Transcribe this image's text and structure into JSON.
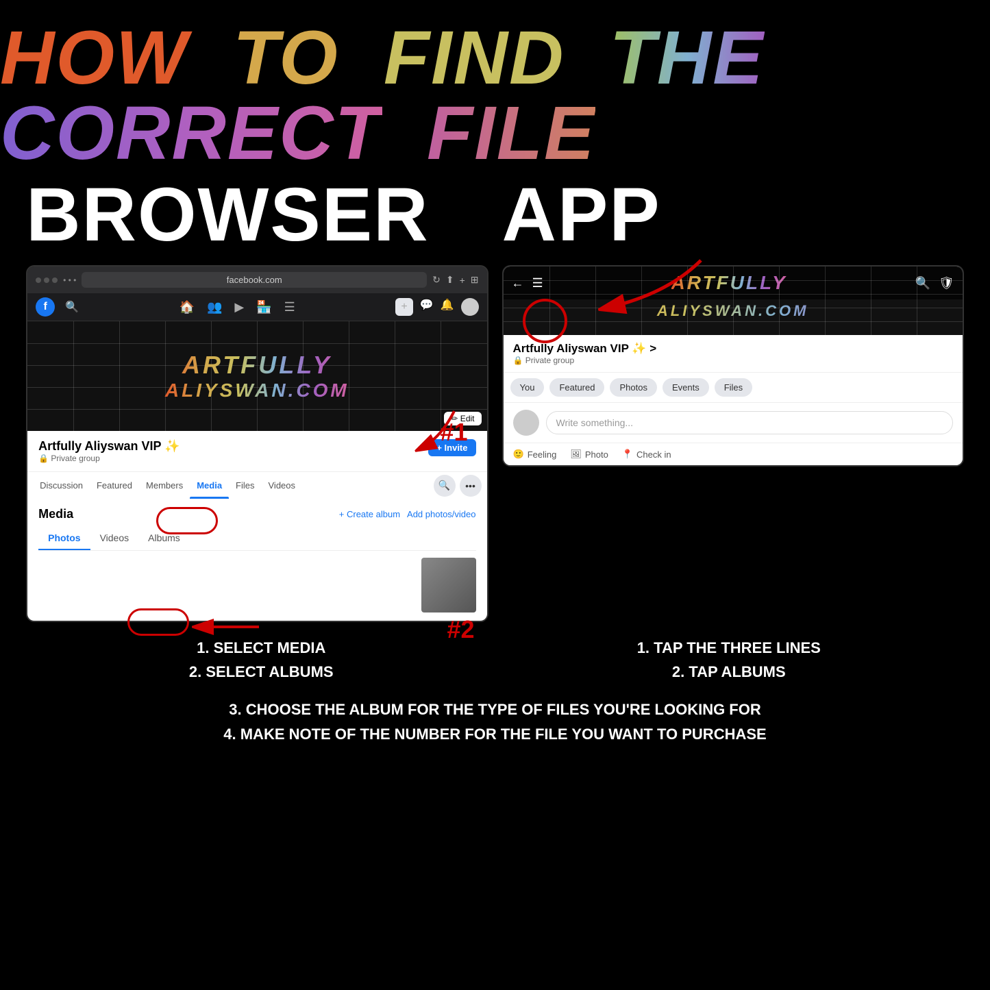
{
  "title": {
    "line1": "HOW TO FIND THE CORRECT FILE",
    "how": "HOW",
    "to": "TO",
    "find": "FIND",
    "the": "THE",
    "correct": "CORRECT",
    "file": "FILE"
  },
  "browser_column": {
    "label": "BROWSER",
    "browser_bar": {
      "url": "facebook.com"
    },
    "cover": {
      "line1": "ARTFULLY",
      "line2": "ALIYSWAN.COM"
    },
    "profile": {
      "name": "Artfully Aliyswan VIP ✨",
      "type": "🔒 Private group"
    },
    "tabs": [
      "Discussion",
      "Featured",
      "Members",
      "Media",
      "Files",
      "Videos"
    ],
    "media_section": {
      "title": "Media",
      "create_album": "+ Create album",
      "add_photos": "Add photos/video",
      "sub_tabs": [
        "Photos",
        "Videos",
        "Albums"
      ]
    },
    "invite_button": "+ Invite",
    "edit_button": "✏ Edit",
    "annotations": {
      "number1": "#1",
      "number2": "#2"
    }
  },
  "app_column": {
    "label": "APP",
    "cover": {
      "line1": "ARTFULLY",
      "line2": "ALIYSWAN.COM"
    },
    "profile": {
      "name": "Artfully Aliyswan VIP ✨ >",
      "type": "🔒 Private group"
    },
    "tabs": [
      "You",
      "Featured",
      "Photos",
      "Events",
      "Files"
    ],
    "write_placeholder": "Write something...",
    "actions": [
      "Feeling",
      "Photo",
      "Check in"
    ]
  },
  "instructions": {
    "browser_steps": [
      "1. SELECT MEDIA",
      "2. SELECT ALBUMS"
    ],
    "app_steps": [
      "1. TAP THE THREE LINES",
      "2. TAP ALBUMS"
    ],
    "shared_steps": [
      "3. CHOOSE THE ALBUM FOR THE TYPE OF FILES YOU'RE LOOKING FOR",
      "4. MAKE NOTE OF THE NUMBER FOR THE FILE YOU WANT TO PURCHASE"
    ]
  }
}
